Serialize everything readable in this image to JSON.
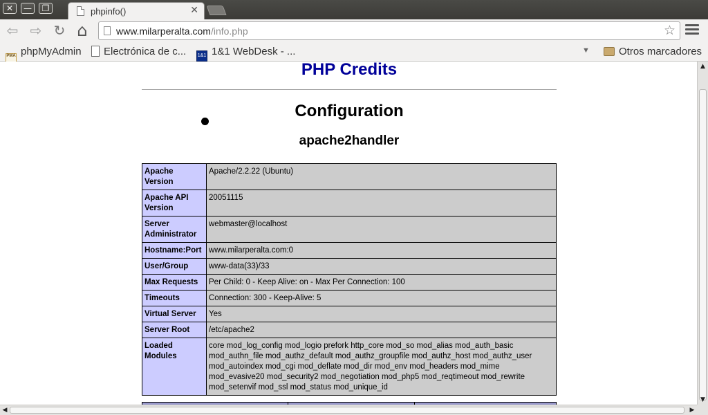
{
  "window": {
    "close_glyph": "✕",
    "minimize_glyph": "—",
    "maximize_glyph": "❐"
  },
  "tab": {
    "title": "phpinfo()",
    "close_glyph": "✕"
  },
  "toolbar": {
    "back_glyph": "⇦",
    "forward_glyph": "⇨",
    "reload_glyph": "↻",
    "home_glyph": "⌂",
    "url_host": "www.milarperalta.com",
    "url_path": "/info.php",
    "bookmark_star": "☆"
  },
  "bookmarks": {
    "items": [
      {
        "label": "phpMyAdmin",
        "icon": "pma-icon",
        "icon_text": "PMA"
      },
      {
        "label": "Electrónica de c...",
        "icon": "document-icon"
      },
      {
        "label": "1&1 WebDesk - ...",
        "icon": "webdesk-icon",
        "icon_text": "1&1"
      }
    ],
    "overflow_glyph": "▼",
    "other_label": "Otros marcadores"
  },
  "page": {
    "credits_link": "PHP Credits",
    "config_heading": "Configuration",
    "module_heading": "apache2handler",
    "table": [
      {
        "label": "Apache Version",
        "value": "Apache/2.2.22 (Ubuntu)"
      },
      {
        "label": "Apache API Version",
        "value": "20051115"
      },
      {
        "label": "Server Administrator",
        "value": "webmaster@localhost"
      },
      {
        "label": "Hostname:Port",
        "value": "www.milarperalta.com:0"
      },
      {
        "label": "User/Group",
        "value": "www-data(33)/33"
      },
      {
        "label": "Max Requests",
        "value": "Per Child: 0 - Keep Alive: on - Max Per Connection: 100"
      },
      {
        "label": "Timeouts",
        "value": "Connection: 300 - Keep-Alive: 5"
      },
      {
        "label": "Virtual Server",
        "value": "Yes"
      },
      {
        "label": "Server Root",
        "value": "/etc/apache2"
      },
      {
        "label": "Loaded Modules",
        "value": "core mod_log_config mod_logio prefork http_core mod_so mod_alias mod_auth_basic mod_authn_file mod_authz_default mod_authz_groupfile mod_authz_host mod_authz_user mod_autoindex mod_cgi mod_deflate mod_dir mod_env mod_headers mod_mime mod_evasive20 mod_security2 mod_negotiation mod_php5 mod_reqtimeout mod_rewrite mod_setenvif mod_ssl mod_status mod_unique_id"
      }
    ]
  },
  "colors": {
    "credits": "#000099",
    "label_cell": "#ccccff",
    "value_cell": "#cccccc",
    "header_row": "#9999cc"
  }
}
